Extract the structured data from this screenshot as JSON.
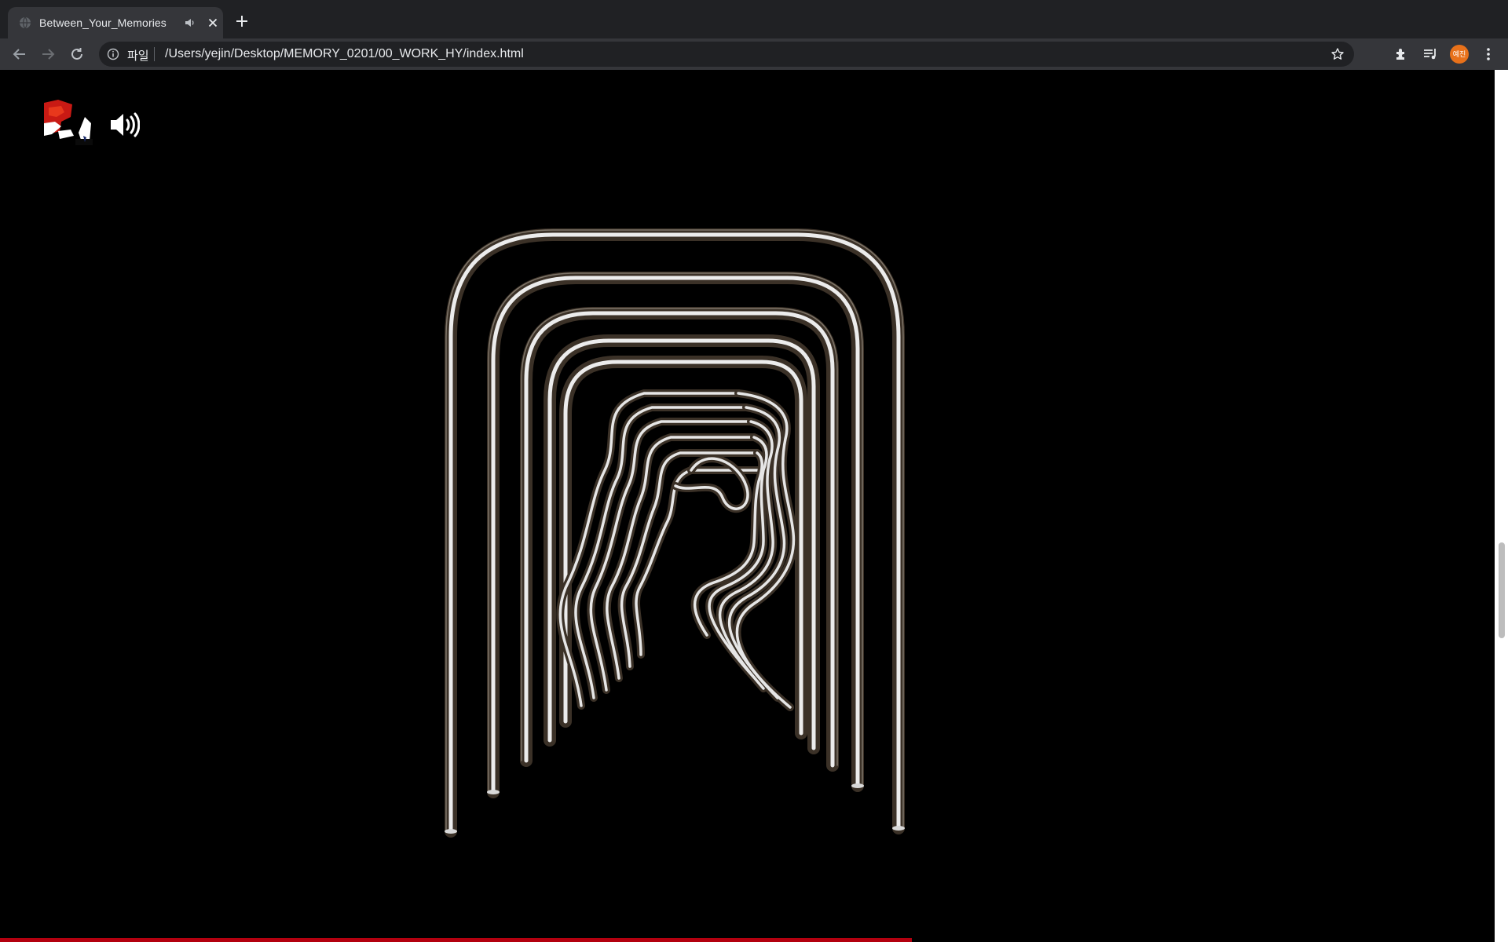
{
  "browser": {
    "tab": {
      "title": "Between_Your_Memories",
      "favicon": "globe-icon",
      "audio_icon": "speaker-icon"
    },
    "omnibox": {
      "scheme_label": "파일",
      "url": "/Users/yejin/Desktop/MEMORY_0201/00_WORK_HY/index.html"
    },
    "profile": {
      "initials": "예진",
      "color": "#e8711a"
    }
  },
  "page": {
    "logo": "logo-image",
    "sound_button": "speaker-volume-icon",
    "artwork": "chrome-tube-arches",
    "progress": {
      "fraction": 0.61,
      "color": "#b3000f"
    },
    "scroll": {
      "thumb_fraction_start": 0.49
    }
  },
  "colors": {
    "background": "#000000",
    "tabstrip": "#202124",
    "toolbar": "#35363a",
    "accent_red": "#b3000f"
  }
}
